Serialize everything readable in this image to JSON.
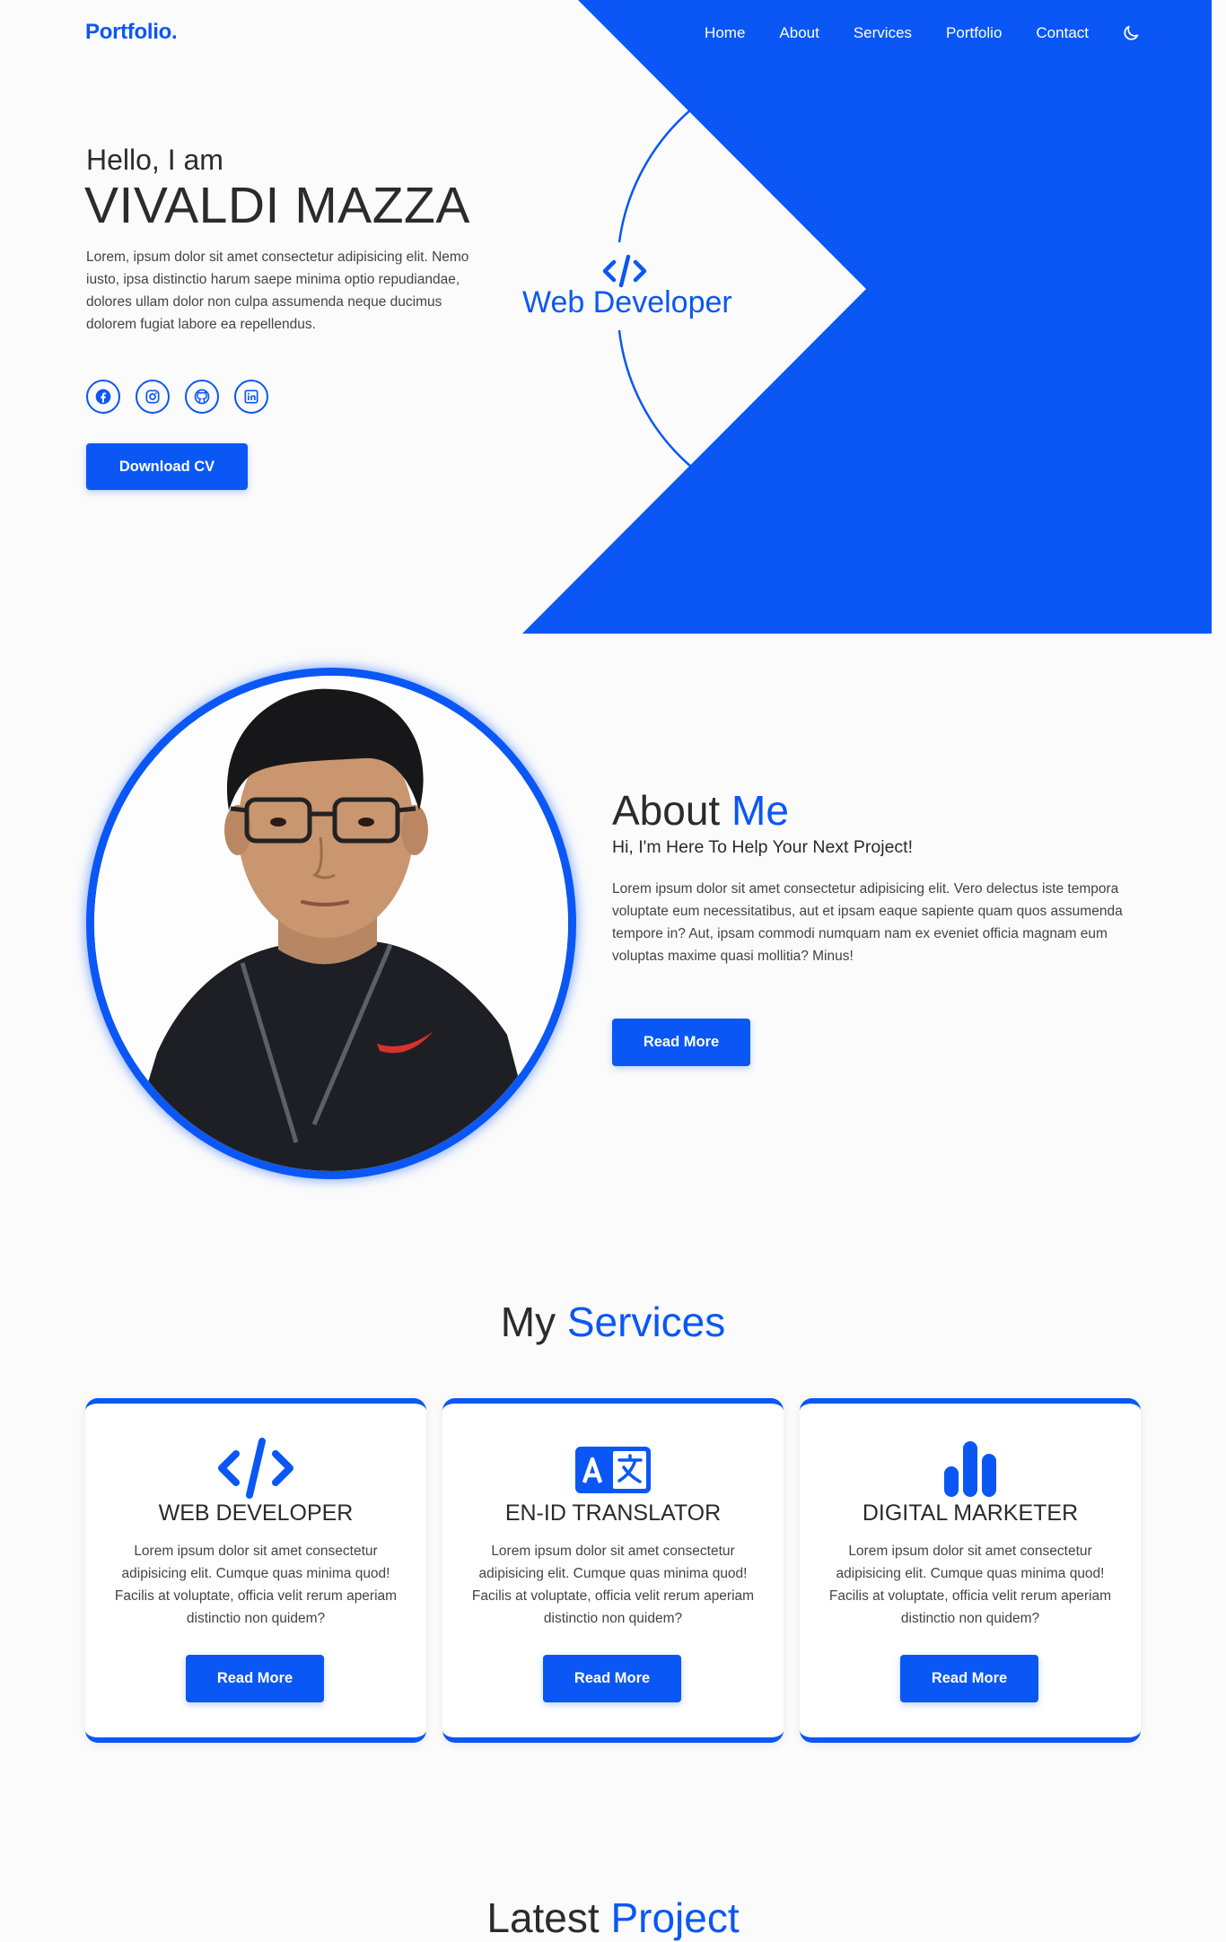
{
  "colors": {
    "accent": "#0a57f5",
    "background": "#fbfbfb",
    "text": "#2b2b2b"
  },
  "header": {
    "logo": "Portfolio.",
    "nav": [
      "Home",
      "About",
      "Services",
      "Portfolio",
      "Contact"
    ],
    "theme_toggle_icon": "moon-icon"
  },
  "hero": {
    "greeting": "Hello, I am",
    "name": "VIVALDI MAZZA",
    "description": "Lorem, ipsum dolor sit amet consectetur adipisicing elit. Nemo iusto, ipsa distinctio harum saepe minima optio repudiandae, dolores ullam dolor non culpa assumenda neque ducimus dolorem fugiat labore ea repellendus.",
    "socials": [
      "facebook-icon",
      "instagram-icon",
      "github-icon",
      "linkedin-icon"
    ],
    "cv_button": "Download CV",
    "role_icon": "code-icon",
    "role": "Web Developer"
  },
  "about": {
    "title_plain": "About",
    "title_accent": "Me",
    "subtitle": "Hi, I'm Here To Help Your Next Project!",
    "description": "Lorem ipsum dolor sit amet consectetur adipisicing elit. Vero delectus iste tempora voluptate eum necessitatibus, aut et ipsam eaque sapiente quam quos assumenda tempore in? Aut, ipsam commodi numquam nam ex eveniet officia magnam eum voluptas maxime quasi mollitia? Minus!",
    "button": "Read More"
  },
  "services": {
    "title_plain": "My",
    "title_accent": "Services",
    "cards": [
      {
        "icon": "code-icon",
        "title": "WEB DEVELOPER",
        "text": "Lorem ipsum dolor sit amet consectetur adipisicing elit. Cumque quas minima quod! Facilis at voluptate, officia velit rerum aperiam distinctio non quidem?",
        "button": "Read More"
      },
      {
        "icon": "translate-icon",
        "title": "EN-ID TRANSLATOR",
        "text": "Lorem ipsum dolor sit amet consectetur adipisicing elit. Cumque quas minima quod! Facilis at voluptate, officia velit rerum aperiam distinctio non quidem?",
        "button": "Read More"
      },
      {
        "icon": "bar-chart-icon",
        "title": "DIGITAL MARKETER",
        "text": "Lorem ipsum dolor sit amet consectetur adipisicing elit. Cumque quas minima quod! Facilis at voluptate, officia velit rerum aperiam distinctio non quidem?",
        "button": "Read More"
      }
    ]
  },
  "latest": {
    "title_plain": "Latest",
    "title_accent": "Project"
  }
}
